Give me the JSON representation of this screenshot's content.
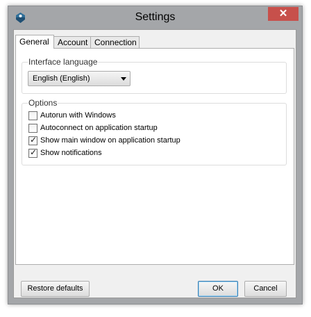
{
  "window": {
    "title": "Settings",
    "close_label": "✕",
    "app_icon": "app-logo-icon"
  },
  "tabs": [
    {
      "label": "General",
      "active": true
    },
    {
      "label": "Account",
      "active": false
    },
    {
      "label": "Connection",
      "active": false
    }
  ],
  "interface_language": {
    "group_title": "Interface language",
    "selected": "English (English)"
  },
  "options": {
    "group_title": "Options",
    "items": [
      {
        "label": "Autorun with Windows",
        "checked": false
      },
      {
        "label": "Autoconnect on application startup",
        "checked": false
      },
      {
        "label": "Show main window on application startup",
        "checked": true
      },
      {
        "label": "Show notifications",
        "checked": true
      }
    ]
  },
  "buttons": {
    "restore_defaults": "Restore defaults",
    "ok": "OK",
    "cancel": "Cancel"
  },
  "colors": {
    "close_button": "#c7504b",
    "window_frame": "#a4a6a9",
    "default_button_border": "#3c7fb1"
  }
}
